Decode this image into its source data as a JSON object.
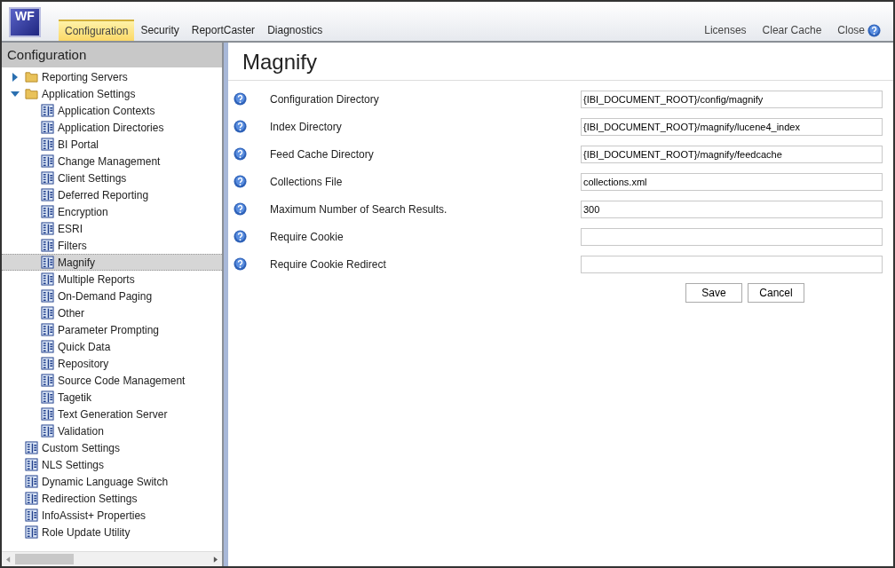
{
  "logo": "WF",
  "tabs": [
    {
      "label": "Configuration",
      "selected": true
    },
    {
      "label": "Security",
      "selected": false
    },
    {
      "label": "ReportCaster",
      "selected": false
    },
    {
      "label": "Diagnostics",
      "selected": false
    }
  ],
  "top_links": [
    "Licenses",
    "Clear Cache",
    "Close"
  ],
  "sidebar": {
    "title": "Configuration",
    "items": [
      {
        "label": "Reporting Servers",
        "kind": "folder",
        "expanded": false,
        "selected": false
      },
      {
        "label": "Application Settings",
        "kind": "folder",
        "expanded": true,
        "selected": false,
        "children": [
          {
            "label": "Application Contexts",
            "kind": "file",
            "selected": false
          },
          {
            "label": "Application Directories",
            "kind": "file",
            "selected": false
          },
          {
            "label": "BI Portal",
            "kind": "file",
            "selected": false
          },
          {
            "label": "Change Management",
            "kind": "file",
            "selected": false
          },
          {
            "label": "Client Settings",
            "kind": "file",
            "selected": false
          },
          {
            "label": "Deferred Reporting",
            "kind": "file",
            "selected": false
          },
          {
            "label": "Encryption",
            "kind": "file",
            "selected": false
          },
          {
            "label": "ESRI",
            "kind": "file",
            "selected": false
          },
          {
            "label": "Filters",
            "kind": "file",
            "selected": false
          },
          {
            "label": "Magnify",
            "kind": "file",
            "selected": true
          },
          {
            "label": "Multiple Reports",
            "kind": "file",
            "selected": false
          },
          {
            "label": "On-Demand Paging",
            "kind": "file",
            "selected": false
          },
          {
            "label": "Other",
            "kind": "file",
            "selected": false
          },
          {
            "label": "Parameter Prompting",
            "kind": "file",
            "selected": false
          },
          {
            "label": "Quick Data",
            "kind": "file",
            "selected": false
          },
          {
            "label": "Repository",
            "kind": "file",
            "selected": false
          },
          {
            "label": "Source Code Management",
            "kind": "file",
            "selected": false
          },
          {
            "label": "Tagetik",
            "kind": "file",
            "selected": false
          },
          {
            "label": "Text Generation Server",
            "kind": "file",
            "selected": false
          },
          {
            "label": "Validation",
            "kind": "file",
            "selected": false
          }
        ]
      },
      {
        "label": "Custom Settings",
        "kind": "file",
        "selected": false
      },
      {
        "label": "NLS Settings",
        "kind": "file",
        "selected": false
      },
      {
        "label": "Dynamic Language Switch",
        "kind": "file",
        "selected": false
      },
      {
        "label": "Redirection Settings",
        "kind": "file",
        "selected": false
      },
      {
        "label": "InfoAssist+ Properties",
        "kind": "file",
        "selected": false
      },
      {
        "label": "Role Update Utility",
        "kind": "file",
        "selected": false
      }
    ]
  },
  "main": {
    "title": "Magnify",
    "settings": [
      {
        "label": "Configuration Directory",
        "value": "{IBI_DOCUMENT_ROOT}/config/magnify"
      },
      {
        "label": "Index Directory",
        "value": "{IBI_DOCUMENT_ROOT}/magnify/lucene4_index"
      },
      {
        "label": "Feed Cache Directory",
        "value": "{IBI_DOCUMENT_ROOT}/magnify/feedcache"
      },
      {
        "label": "Collections File",
        "value": "collections.xml"
      },
      {
        "label": "Maximum Number of Search Results.",
        "value": "300"
      },
      {
        "label": "Require Cookie"
      },
      {
        "label": "Require Cookie Redirect"
      }
    ],
    "buttons": [
      "Save",
      "Cancel"
    ]
  }
}
